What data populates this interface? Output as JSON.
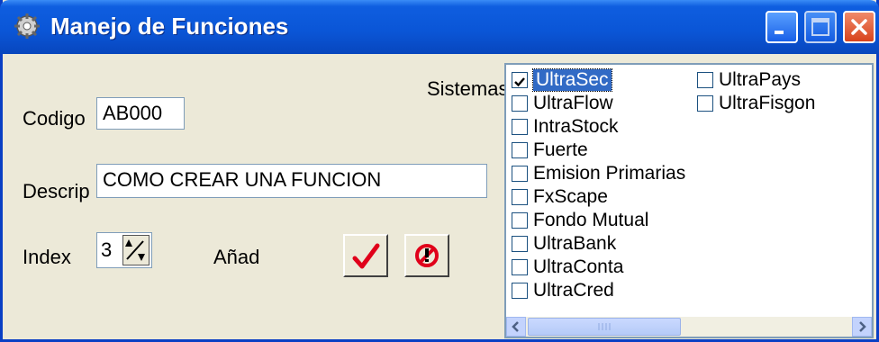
{
  "window": {
    "title": "Manejo de Funciones"
  },
  "form": {
    "codigo_label": "Codigo",
    "codigo_value": "AB000",
    "descrip_label": "Descrip",
    "descrip_value": "COMO CREAR UNA FUNCION",
    "index_label": "Index",
    "index_value": "3",
    "anad_label": "Añad",
    "sistemas_label": "Sistemas"
  },
  "systems": [
    {
      "label": "UltraSec",
      "checked": true,
      "selected": true
    },
    {
      "label": "UltraFlow",
      "checked": false
    },
    {
      "label": "IntraStock",
      "checked": false
    },
    {
      "label": "Fuerte",
      "checked": false
    },
    {
      "label": "Emision Primarias",
      "checked": false
    },
    {
      "label": "FxScape",
      "checked": false
    },
    {
      "label": "Fondo Mutual",
      "checked": false
    },
    {
      "label": "UltraBank",
      "checked": false
    },
    {
      "label": "UltraConta",
      "checked": false
    },
    {
      "label": "UltraCred",
      "checked": false
    },
    {
      "label": "UltraPays",
      "checked": false
    },
    {
      "label": "UltraFisgon",
      "checked": false
    }
  ],
  "colors": {
    "titlebar": "#0a55d6",
    "selection": "#316ac5",
    "confirm_check": "#e0001a"
  }
}
